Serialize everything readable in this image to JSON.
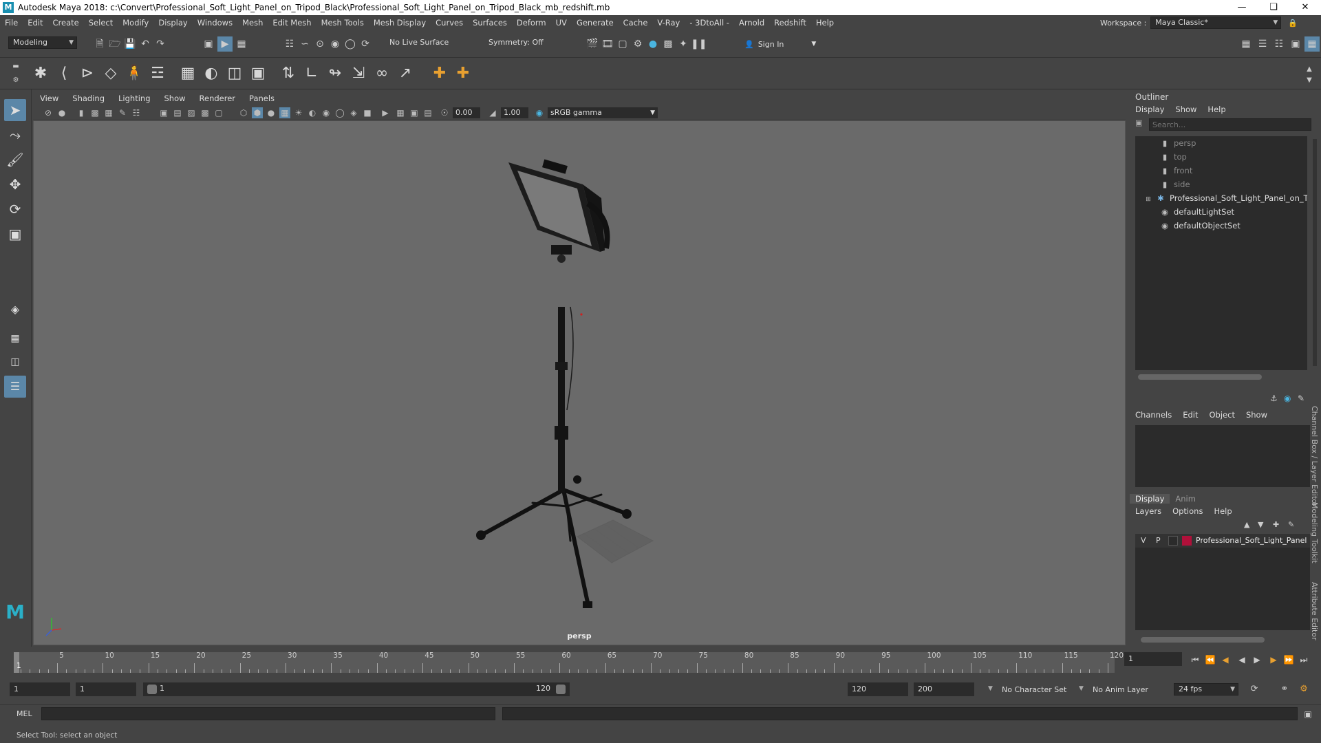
{
  "window": {
    "title": "Autodesk Maya 2018: c:\\Convert\\Professional_Soft_Light_Panel_on_Tripod_Black\\Professional_Soft_Light_Panel_on_Tripod_Black_mb_redshift.mb",
    "logo_letter": "M"
  },
  "menubar": {
    "items": [
      "File",
      "Edit",
      "Create",
      "Select",
      "Modify",
      "Display",
      "Windows",
      "Mesh",
      "Edit Mesh",
      "Mesh Tools",
      "Mesh Display",
      "Curves",
      "Surfaces",
      "Deform",
      "UV",
      "Generate",
      "Cache",
      "V-Ray",
      "- 3DtoAll -",
      "Arnold",
      "Redshift",
      "Help"
    ],
    "workspace_label": "Workspace :",
    "workspace_value": "Maya Classic*"
  },
  "statusline": {
    "menuset": "Modeling",
    "live_surface": "No Live Surface",
    "symmetry": "Symmetry: Off",
    "sign_in": "Sign In"
  },
  "viewport": {
    "menu": [
      "View",
      "Shading",
      "Lighting",
      "Show",
      "Renderer",
      "Panels"
    ],
    "exposure": "0.00",
    "gamma": "1.00",
    "color_space": "sRGB gamma",
    "camera_label": "persp"
  },
  "outliner": {
    "title": "Outliner",
    "menu": [
      "Display",
      "Show",
      "Help"
    ],
    "search_placeholder": "Search...",
    "items": [
      {
        "label": "persp",
        "type": "camera",
        "dim": true
      },
      {
        "label": "top",
        "type": "camera",
        "dim": true
      },
      {
        "label": "front",
        "type": "camera",
        "dim": true
      },
      {
        "label": "side",
        "type": "camera",
        "dim": true
      },
      {
        "label": "Professional_Soft_Light_Panel_on_Tripod",
        "type": "group",
        "dim": false
      },
      {
        "label": "defaultLightSet",
        "type": "set",
        "dim": false
      },
      {
        "label": "defaultObjectSet",
        "type": "set",
        "dim": false
      }
    ]
  },
  "channelbox": {
    "menu": [
      "Channels",
      "Edit",
      "Object",
      "Show"
    ],
    "side_label": "Channel Box / Layer Editor"
  },
  "layers": {
    "tabs": [
      "Display",
      "Anim"
    ],
    "menu": [
      "Layers",
      "Options",
      "Help"
    ],
    "layer": {
      "v": "V",
      "p": "P",
      "name": "Professional_Soft_Light_Panel",
      "color": "#b0103a"
    }
  },
  "side_tabs": [
    "Modeling Toolkit",
    "Attribute Editor"
  ],
  "timeline": {
    "ticks": [
      "5",
      "10",
      "15",
      "20",
      "25",
      "30",
      "35",
      "40",
      "45",
      "50",
      "55",
      "60",
      "65",
      "70",
      "75",
      "80",
      "85",
      "90",
      "95",
      "100",
      "105",
      "110",
      "115",
      "120"
    ],
    "start_marker": "1",
    "current_frame": "1"
  },
  "range": {
    "start": "1",
    "playback_start": "1",
    "slider_start": "1",
    "slider_end": "120",
    "playback_end": "120",
    "end": "200",
    "character_set": "No Character Set",
    "anim_layer": "No Anim Layer",
    "fps": "24 fps"
  },
  "cmdline": {
    "label": "MEL"
  },
  "helpline": {
    "text": "Select Tool: select an object"
  }
}
